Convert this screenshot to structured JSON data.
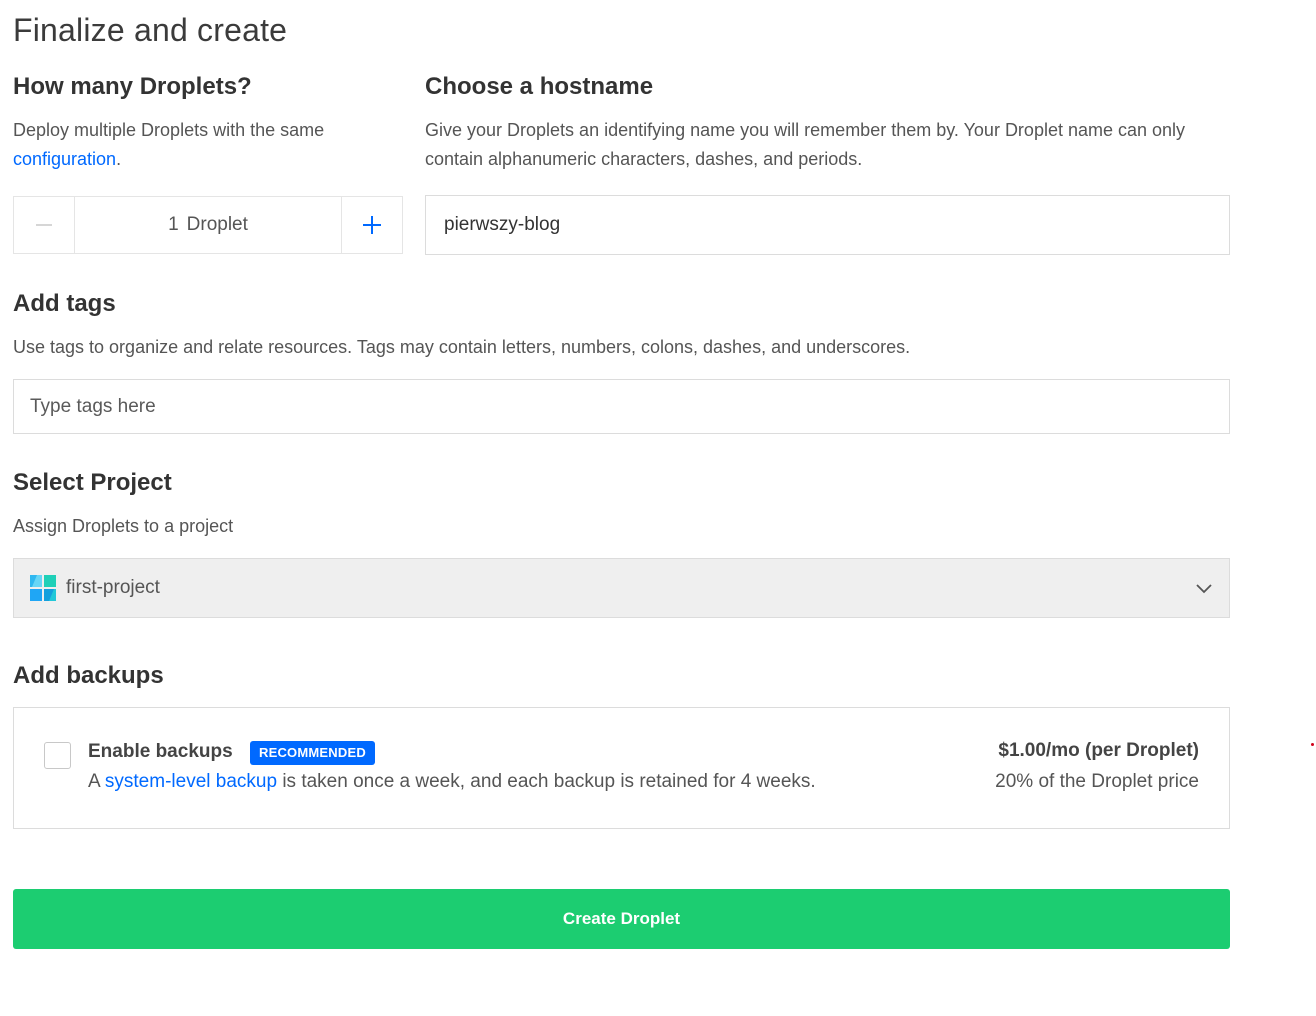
{
  "page": {
    "title": "Finalize and create"
  },
  "droplets": {
    "title": "How many Droplets?",
    "desc_prefix": "Deploy multiple Droplets with the same",
    "desc_link": "configuration",
    "desc_suffix": ".",
    "count": "1",
    "unit": "Droplet",
    "minus_icon": "minus-icon",
    "plus_icon": "plus-icon"
  },
  "hostname": {
    "title": "Choose a hostname",
    "desc": "Give your Droplets an identifying name you will remember them by. Your Droplet name can only contain alphanumeric characters, dashes, and periods.",
    "value": "pierwszy-blog"
  },
  "tags": {
    "title": "Add tags",
    "desc": "Use tags to organize and relate resources. Tags may contain letters, numbers, colons, dashes, and underscores.",
    "placeholder": "Type tags here"
  },
  "project": {
    "title": "Select Project",
    "desc": "Assign Droplets to a project",
    "selected": "first-project",
    "icon": "project-icon",
    "dropdown_icon": "chevron-down-icon"
  },
  "backups": {
    "title": "Add backups",
    "enable_label": "Enable backups",
    "badge": "RECOMMENDED",
    "desc_prefix": "A",
    "desc_link": "system-level backup",
    "desc_suffix": "is taken once a week, and each backup is retained for 4 weeks.",
    "price": "$1.00/mo (per Droplet)",
    "price_note": "20% of the Droplet price",
    "checked": false
  },
  "actions": {
    "create_label": "Create Droplet"
  },
  "colors": {
    "accent": "#0069ff",
    "create_button": "#1ccd71",
    "select_bg": "#efefef"
  }
}
